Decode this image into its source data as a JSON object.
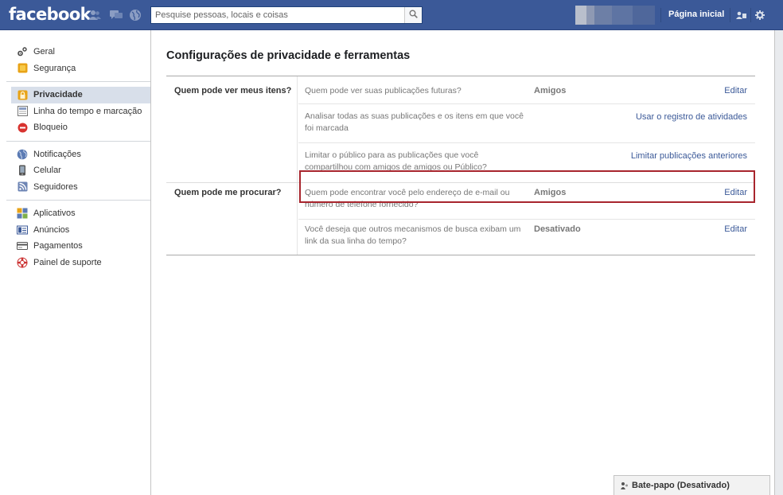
{
  "header": {
    "logo": "facebook",
    "search_placeholder": "Pesquise pessoas, locais e coisas",
    "home_label": "Página inicial",
    "colors": {
      "bar": "#3b5998",
      "link": "#3b5998",
      "highlight": "#a8252d"
    },
    "icons": [
      "friends-icon",
      "messages-icon",
      "notifications-globe-icon",
      "search-icon",
      "privacy-shortcuts-icon",
      "settings-gear-icon"
    ]
  },
  "sidebar": {
    "groups": [
      [
        {
          "label": "Geral",
          "icon": "gear-icon"
        },
        {
          "label": "Segurança",
          "icon": "security-badge-icon"
        }
      ],
      [
        {
          "label": "Privacidade",
          "icon": "privacy-lock-icon",
          "selected": true
        },
        {
          "label": "Linha do tempo e marcação",
          "icon": "timeline-icon"
        },
        {
          "label": "Bloqueio",
          "icon": "block-icon"
        }
      ],
      [
        {
          "label": "Notificações",
          "icon": "globe-icon"
        },
        {
          "label": "Celular",
          "icon": "mobile-phone-icon"
        },
        {
          "label": "Seguidores",
          "icon": "rss-followers-icon"
        }
      ],
      [
        {
          "label": "Aplicativos",
          "icon": "apps-icon"
        },
        {
          "label": "Anúncios",
          "icon": "ads-icon"
        },
        {
          "label": "Pagamentos",
          "icon": "credit-card-icon"
        },
        {
          "label": "Painel de suporte",
          "icon": "lifebuoy-icon"
        }
      ]
    ]
  },
  "main": {
    "title": "Configurações de privacidade e ferramentas",
    "sections": [
      {
        "label": "Quem pode ver meus itens?",
        "rows": [
          {
            "desc": "Quem pode ver suas publicações futuras?",
            "value": "Amigos",
            "action": "Editar"
          },
          {
            "desc": "Analisar todas as suas publicações e os itens em que você foi marcada",
            "value": "",
            "action": "Usar o registro de atividades"
          },
          {
            "desc": "Limitar o público para as publicações que você compartilhou com amigos de amigos ou Público?",
            "value": "",
            "action": "Limitar publicações anteriores"
          }
        ]
      },
      {
        "label": "Quem pode me procurar?",
        "rows": [
          {
            "desc": "Quem pode encontrar você pelo endereço de e-mail ou número de telefone fornecido?",
            "value": "Amigos",
            "action": "Editar",
            "highlighted": true
          },
          {
            "desc": "Você deseja que outros mecanismos de busca exibam um link da sua linha do tempo?",
            "value": "Desativado",
            "action": "Editar"
          }
        ]
      }
    ]
  },
  "chat": {
    "label": "Bate-papo (Desativado)"
  }
}
